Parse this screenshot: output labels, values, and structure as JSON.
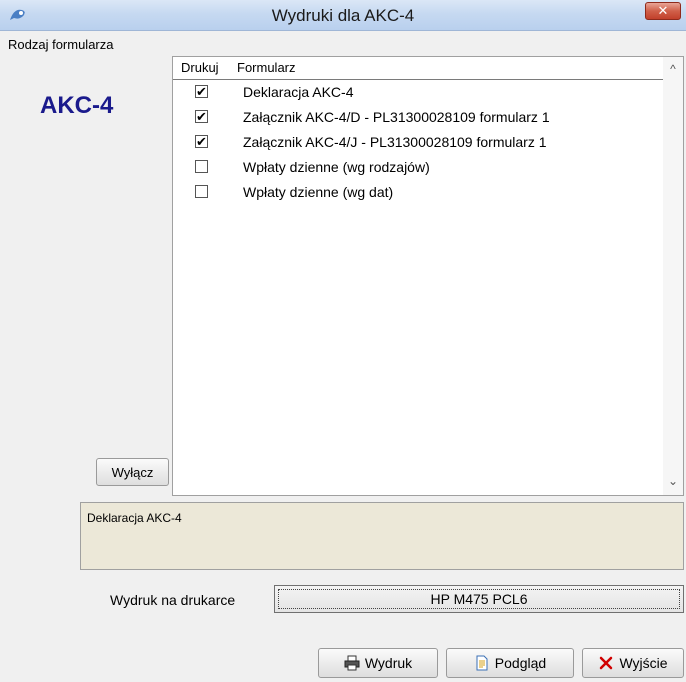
{
  "window": {
    "title": "Wydruki dla AKC-4",
    "close_label": "✕"
  },
  "left": {
    "rodzaj_label": "Rodzaj formularza",
    "form_code": "AKC-4",
    "wylacz_label": "Wyłącz"
  },
  "list": {
    "columns": [
      "Drukuj",
      "Formularz"
    ],
    "items": [
      {
        "label": "Deklaracja AKC-4",
        "checked": true
      },
      {
        "label": "Załącznik AKC-4/D - PL31300028109 formularz 1",
        "checked": true
      },
      {
        "label": "Załącznik AKC-4/J - PL31300028109 formularz 1",
        "checked": true
      },
      {
        "label": "Wpłaty dzienne (wg rodzajów)",
        "checked": false
      },
      {
        "label": "Wpłaty dzienne (wg dat)",
        "checked": false
      }
    ]
  },
  "description": {
    "text": "Deklaracja AKC-4"
  },
  "printer": {
    "label": "Wydruk na drukarce",
    "name": "HP M475 PCL6"
  },
  "buttons": {
    "print": "Wydruk",
    "preview": "Podgląd",
    "exit": "Wyjście"
  },
  "icons": {
    "app": "app-icon",
    "print": "printer-icon",
    "preview": "document-preview-icon",
    "exit": "red-x-icon"
  },
  "colors": {
    "form_code": "#1a1a8c",
    "description_bg": "#ece8d8",
    "close_button": "#c2402b"
  }
}
